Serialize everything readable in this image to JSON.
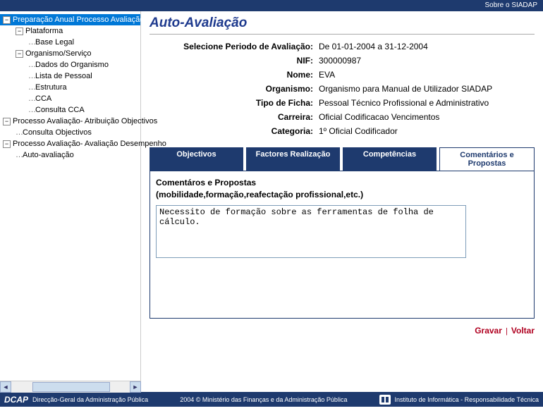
{
  "top": {
    "about": "Sobre o SIADAP"
  },
  "tree": {
    "root": "Preparação Anual Processo Avaliação",
    "plataforma": "Plataforma",
    "base_legal": "Base Legal",
    "organismo": "Organismo/Serviço",
    "dados_org": "Dados do Organismo",
    "lista_pessoal": "Lista de Pessoal",
    "estrutura": "Estrutura",
    "cca": "CCA",
    "consulta_cca": "Consulta CCA",
    "proc_atrib": "Processo Avaliação- Atribuição Objectivos",
    "consulta_obj": "Consulta Objectivos",
    "proc_desemp": "Processo Avaliação- Avaliação Desempenho",
    "auto_aval": "Auto-avaliação"
  },
  "page_title": "Auto-Avaliação",
  "info": {
    "labels": {
      "periodo": "Selecione Periodo de Avaliação:",
      "nif": "NIF:",
      "nome": "Nome:",
      "organismo": "Organismo:",
      "tipo_ficha": "Tipo de Ficha:",
      "carreira": "Carreira:",
      "categoria": "Categoria:"
    },
    "values": {
      "periodo": "De 01-01-2004 a 31-12-2004",
      "nif": "300000987",
      "nome": "EVA",
      "organismo": "Organismo para Manual de Utilizador SIADAP",
      "tipo_ficha": "Pessoal Técnico Profissional e Administrativo",
      "carreira": "Oficial Codificacao Vencimentos",
      "categoria": "1º Oficial Codificador"
    }
  },
  "tabs": {
    "objectivos": "Objectivos",
    "factores": "Factores Realização",
    "competencias": "Competências",
    "comentarios": "Comentários e Propostas"
  },
  "panel": {
    "heading_l1": "Comentáros e Propostas",
    "heading_l2": "(mobilidade,formação,reafectação profissional,etc.)",
    "comment_value": "Necessito de formação sobre as ferramentas de folha de cálculo."
  },
  "actions": {
    "gravar": "Gravar",
    "voltar": "Voltar"
  },
  "footer": {
    "left_logo": "DCAP",
    "left_text": "Direcção-Geral da Administração Pública",
    "center": "2004 © Ministério das Finanças e da Administração Pública",
    "right": "Instituto de Informática - Responsabilidade Técnica"
  }
}
